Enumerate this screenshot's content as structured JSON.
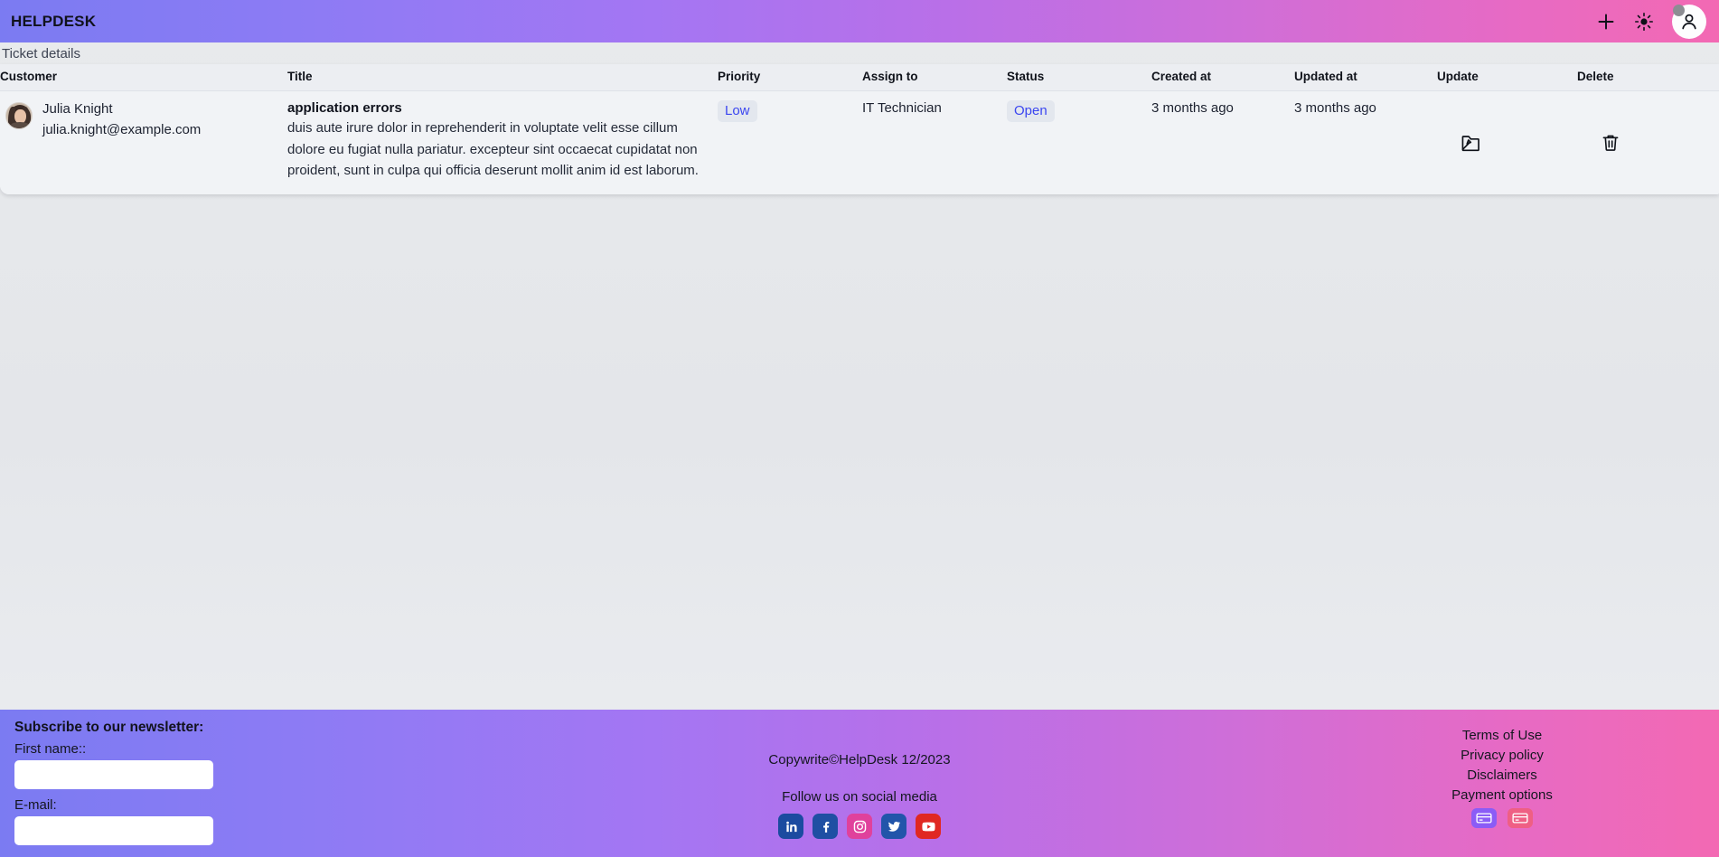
{
  "header": {
    "brand": "HELPDESK",
    "add_icon": "plus-icon",
    "theme_icon": "sun-brightness-icon",
    "avatar_icon": "user-avatar-icon"
  },
  "page": {
    "subtitle": "Ticket details"
  },
  "table": {
    "columns": [
      "Customer",
      "Title",
      "Priority",
      "Assign to",
      "Status",
      "Created at",
      "Updated at",
      "Update",
      "Delete"
    ],
    "rows": [
      {
        "customer_name": "Julia Knight",
        "customer_email": "julia.knight@example.com",
        "avatar": "customer-photo",
        "title": "application errors",
        "description": "duis aute irure dolor in reprehenderit in voluptate velit esse cillum dolore eu fugiat nulla pariatur. excepteur sint occaecat cupidatat non proident, sunt in culpa qui officia deserunt mollit anim id est laborum.",
        "priority": "Low",
        "assign_to": "IT Technician",
        "status": "Open",
        "created_at": "3 months ago",
        "updated_at": "3 months ago",
        "update_icon": "folder-edit-icon",
        "delete_icon": "trash-icon"
      }
    ]
  },
  "footer": {
    "newsletter": {
      "heading": "Subscribe to our newsletter:",
      "first_name_label": "First name::",
      "first_name_value": "",
      "first_name_placeholder": "",
      "email_label": "E-mail:",
      "email_value": "",
      "email_placeholder": ""
    },
    "center": {
      "copyright": "Copywrite©HelpDesk 12/2023",
      "follow": "Follow us on social media",
      "socials": [
        {
          "name": "linkedin-icon",
          "color": "#1b4ba0"
        },
        {
          "name": "facebook-icon",
          "color": "#1f4fa3"
        },
        {
          "name": "instagram-icon",
          "color": "#e0419c"
        },
        {
          "name": "twitter-icon",
          "color": "#2255aa"
        },
        {
          "name": "youtube-icon",
          "color": "#e02822"
        }
      ]
    },
    "links": [
      "Terms of Use",
      "Privacy policy",
      "Disclaimers",
      "Payment options"
    ],
    "payments": [
      {
        "name": "visa-card-icon",
        "color": "#8b5cf6"
      },
      {
        "name": "mastercard-card-icon",
        "color": "#ef5f84"
      }
    ]
  },
  "colors": {
    "gradient_start": "#7b7bf2",
    "gradient_end": "#f369b3",
    "badge_text": "#3b46f0",
    "badge_bg": "#e3e7ee",
    "card_bg": "#f1f3f6",
    "page_bg": "#e4e6ea"
  }
}
